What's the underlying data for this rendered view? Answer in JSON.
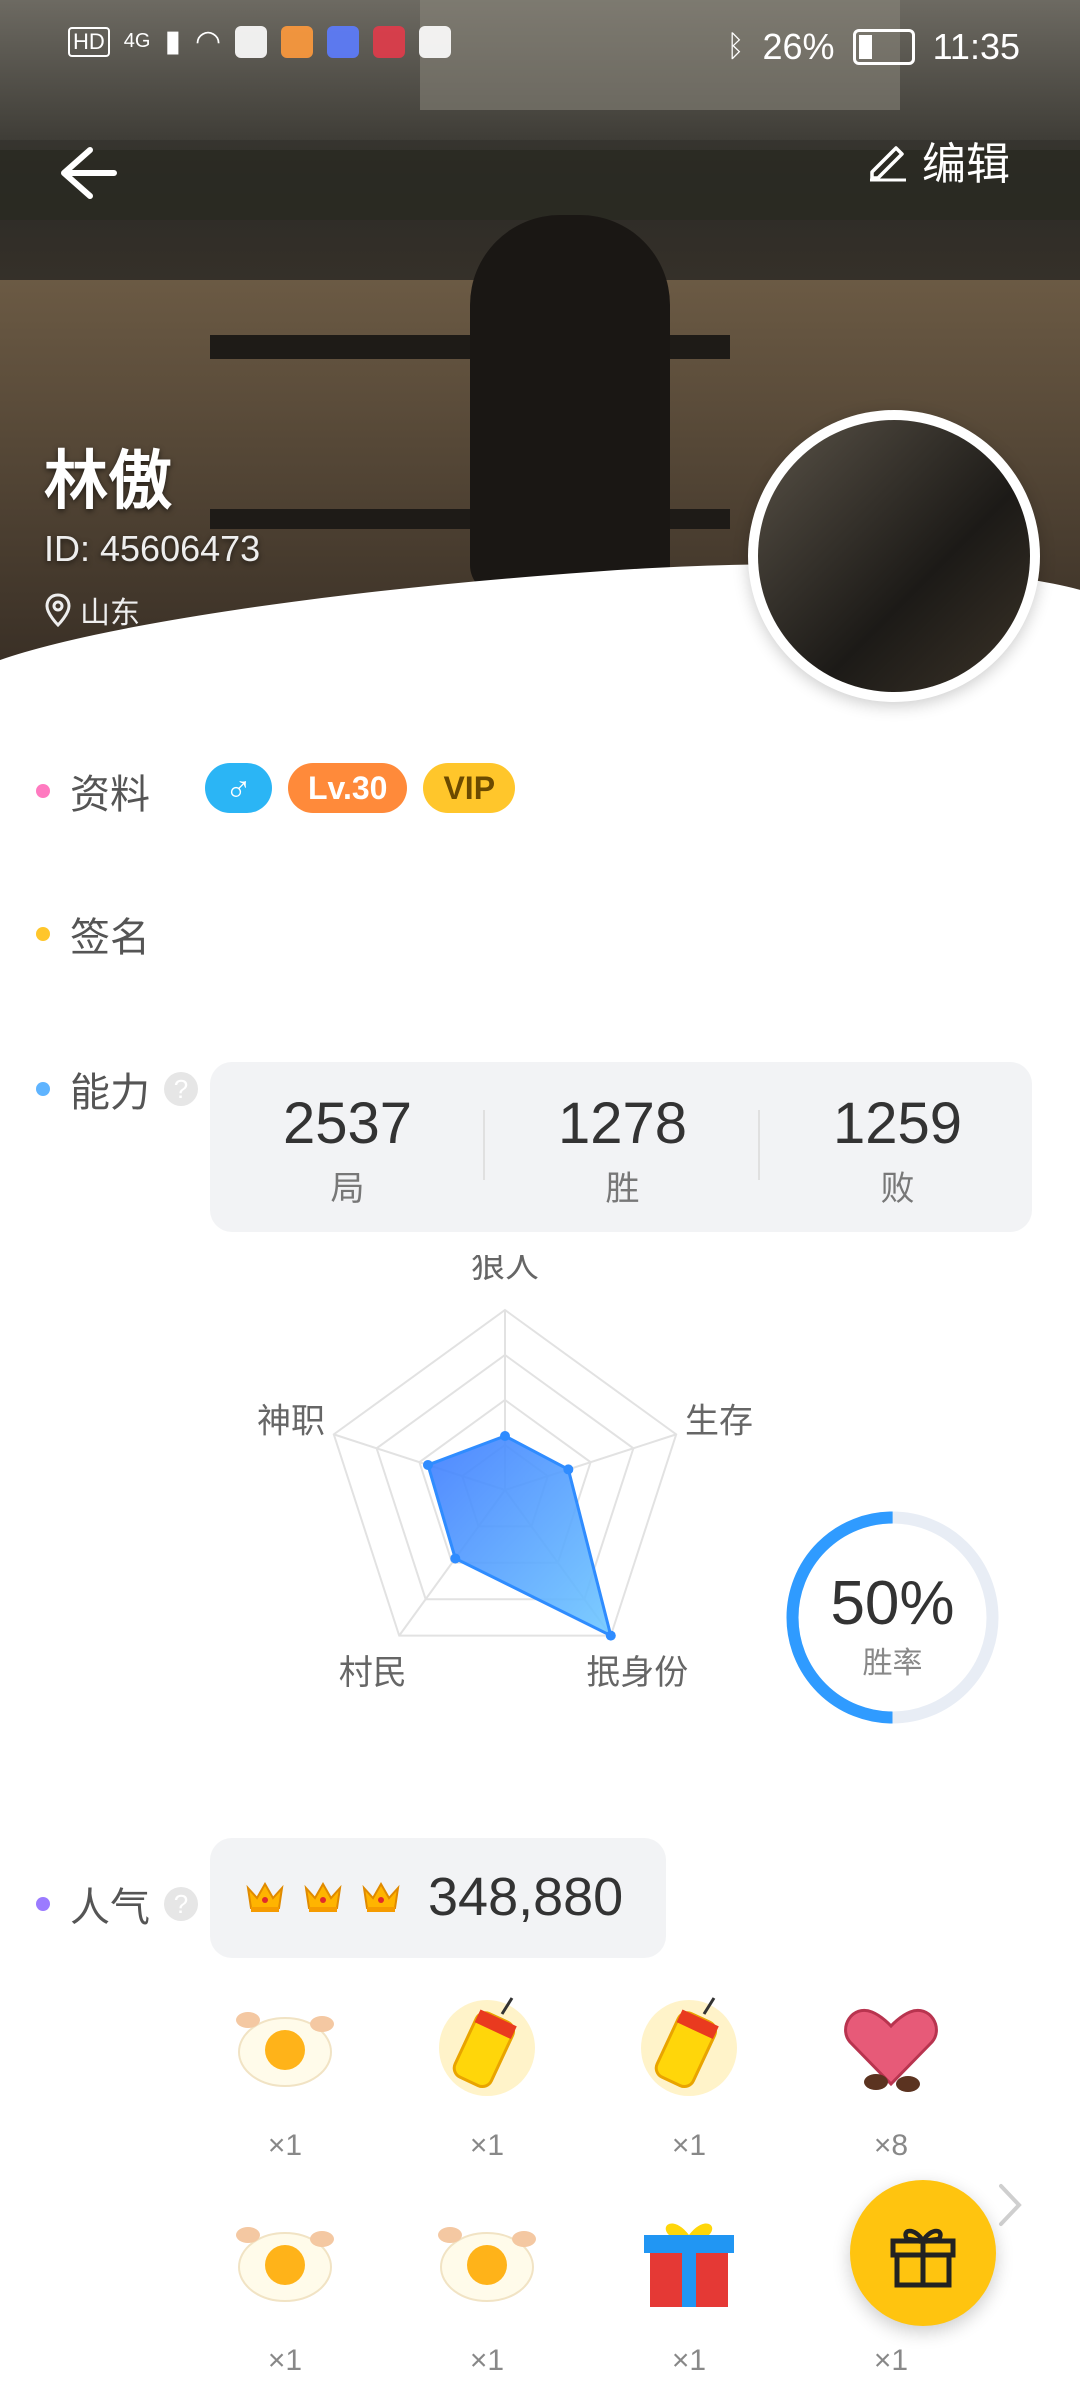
{
  "status_bar": {
    "hd": "HD",
    "net": "4G",
    "battery": "26%",
    "time": "11:35"
  },
  "header": {
    "edit_label": "编辑"
  },
  "profile": {
    "name": "林傲",
    "id": "ID: 45606473",
    "location": "山东"
  },
  "sections": {
    "info": {
      "label": "资料",
      "dot_color": "#ff7ac0"
    },
    "signature": {
      "label": "签名",
      "dot_color": "#ffc62b"
    },
    "ability": {
      "label": "能力",
      "dot_color": "#5fb4ff"
    },
    "popularity": {
      "label": "人气",
      "dot_color": "#9b7bff"
    }
  },
  "tags": {
    "gender": "♂",
    "level": "Lv.30",
    "vip": "VIP"
  },
  "stats": [
    {
      "value": "2537",
      "label": "局"
    },
    {
      "value": "1278",
      "label": "胜"
    },
    {
      "value": "1259",
      "label": "败"
    }
  ],
  "radar": {
    "axes": [
      "狼人",
      "生存",
      "抿身份",
      "村民",
      "神职"
    ],
    "values": [
      0.3,
      0.37,
      1.0,
      0.47,
      0.45
    ]
  },
  "win_rate": {
    "value": 0.5,
    "text": "50%",
    "label": "胜率"
  },
  "popularity": {
    "crowns": 3,
    "value": "348,880"
  },
  "gifts": [
    {
      "icon": "egg-icon",
      "count": "×1"
    },
    {
      "icon": "firecracker-icon",
      "count": "×1"
    },
    {
      "icon": "firecracker-icon",
      "count": "×1"
    },
    {
      "icon": "heart-chocolate-icon",
      "count": "×8"
    },
    {
      "icon": "egg-icon",
      "count": "×1"
    },
    {
      "icon": "egg-icon",
      "count": "×1"
    },
    {
      "icon": "gift-box-icon",
      "count": "×1"
    },
    {
      "icon": "gift-icon",
      "count": "×1"
    }
  ]
}
